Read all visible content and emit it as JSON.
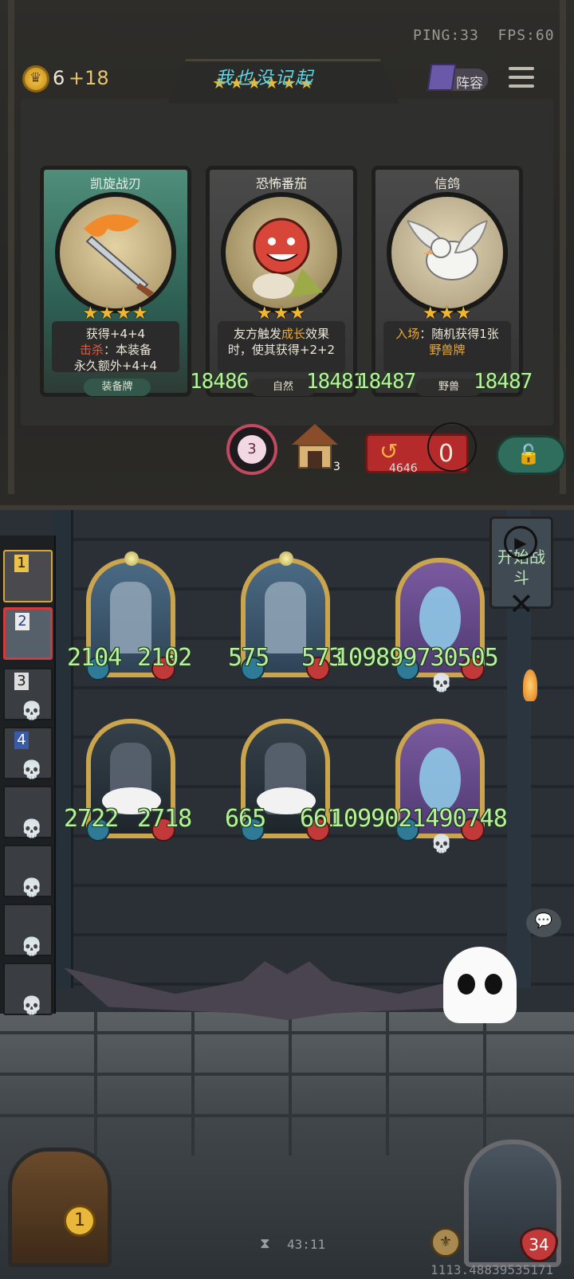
{
  "status": {
    "ping": "PING:33",
    "fps": "FPS:60"
  },
  "gold": {
    "amount": "6",
    "income": "+18"
  },
  "header": {
    "title": "我也没记起",
    "title_stars": "★★★★★★",
    "lineup_label": "阵容"
  },
  "shop_cards": [
    {
      "name": "凯旋战刃",
      "stars": "★★★★",
      "desc_line1": "获得+4+4",
      "desc_kill_label": "击杀",
      "desc_kill_text": "：本装备",
      "desc_line3": "永久额外+4+4",
      "tag": "装备牌"
    },
    {
      "name": "恐怖番茄",
      "stars": "★★★",
      "desc_a": "友方触发",
      "desc_growth": "成长",
      "desc_b": "效果",
      "desc_line2": "时，使其获得+2+2",
      "tag": "自然",
      "num_left": "18486",
      "num_right": "18481"
    },
    {
      "name": "信鸽",
      "stars": "★★★",
      "desc_enter": "入场",
      "desc_a": "：随机获得1张",
      "desc_beast": "野兽牌",
      "tag": "野兽",
      "num_left": "18487",
      "num_right": "18487"
    }
  ],
  "shop_controls": {
    "roll_count": "3",
    "house_count": "3",
    "refresh_cost": "0",
    "refresh_num": "4646"
  },
  "battle_button": {
    "label": "开始战斗",
    "play_icon": "▶",
    "close_icon": "✕"
  },
  "sidebar": {
    "slot1": "1",
    "slot2": "2",
    "slot3": "3",
    "slot4": "4",
    "skull": "💀"
  },
  "board_units": [
    {
      "atk": "2104",
      "hp": "2102"
    },
    {
      "atk": "575",
      "hp": "573"
    },
    {
      "text": "109899730505"
    },
    {
      "atk": "2722",
      "hp": "2718"
    },
    {
      "atk": "665",
      "hp": "661"
    },
    {
      "text": "1099021490748"
    }
  ],
  "bottom": {
    "gate_badge": "1",
    "hourglass": "⧗",
    "timer": "43:11",
    "hero_hp": "34",
    "coords": "1113.48839535171",
    "chat": "💬"
  }
}
